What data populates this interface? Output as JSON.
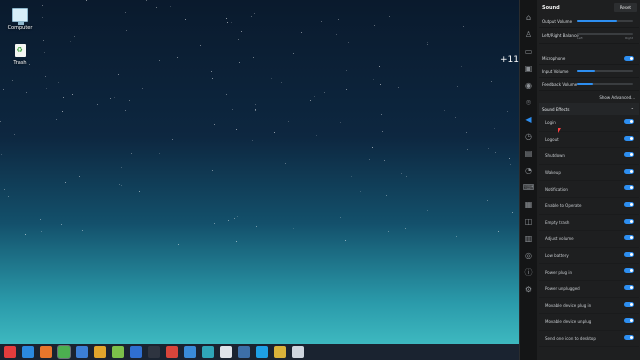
{
  "desktop": {
    "icons": [
      {
        "label": "Computer",
        "icon": "computer-icon"
      },
      {
        "label": "Trash",
        "icon": "trash-icon"
      }
    ],
    "temperature": "+11°"
  },
  "taskbar": {
    "items": [
      {
        "icon": "launcher-icon",
        "color": "#e43d3d"
      },
      {
        "icon": "show-desktop-icon",
        "color": "#2b8ae0"
      },
      {
        "icon": "firefox-icon",
        "color": "#e8762b"
      },
      {
        "icon": "chrome-icon",
        "color": "#4caf50"
      },
      {
        "icon": "file-manager-icon",
        "color": "#3c7fd6"
      },
      {
        "icon": "archive-icon",
        "color": "#e0a52c"
      },
      {
        "icon": "android-studio-icon",
        "color": "#7cc04a"
      },
      {
        "icon": "video-player-icon",
        "color": "#2f6fd1"
      },
      {
        "icon": "terminal-icon",
        "color": "#2e3440"
      },
      {
        "icon": "presentation-icon",
        "color": "#d8453b"
      },
      {
        "icon": "image-viewer-icon",
        "color": "#3a8bd8"
      },
      {
        "icon": "system-monitor-icon",
        "color": "#2fa6b8"
      },
      {
        "icon": "text-editor-icon",
        "color": "#dfe4ea"
      },
      {
        "icon": "screenshot-icon",
        "color": "#3d6fa8"
      },
      {
        "icon": "skype-icon",
        "color": "#1ea0e6"
      },
      {
        "icon": "tool-icon",
        "color": "#d9b23a"
      },
      {
        "icon": "settings-icon",
        "color": "#cfd6de"
      }
    ],
    "active_index": 3
  },
  "panel": {
    "title": "Sound",
    "reset_label": "Reset",
    "nav_icons": [
      {
        "name": "home-icon",
        "glyph": "⌂"
      },
      {
        "name": "user-icon",
        "glyph": "♙"
      },
      {
        "name": "display-icon",
        "glyph": "▭"
      },
      {
        "name": "default-apps-icon",
        "glyph": "▣"
      },
      {
        "name": "personalization-icon",
        "glyph": "◉"
      },
      {
        "name": "network-icon",
        "glyph": "⌾"
      },
      {
        "name": "sound-icon",
        "glyph": "◀"
      },
      {
        "name": "time-icon",
        "glyph": "◷"
      },
      {
        "name": "power-icon",
        "glyph": "▤"
      },
      {
        "name": "mouse-icon",
        "glyph": "◔"
      },
      {
        "name": "keyboard-icon",
        "glyph": "⌨"
      },
      {
        "name": "update-icon",
        "glyph": "▦"
      },
      {
        "name": "wacom-icon",
        "glyph": "◫"
      },
      {
        "name": "printer-icon",
        "glyph": "▥"
      },
      {
        "name": "accessibility-icon",
        "glyph": "◎"
      },
      {
        "name": "info-icon",
        "glyph": "ⓘ"
      },
      {
        "name": "general-settings-icon",
        "glyph": "⚙"
      }
    ],
    "active_nav_index": 6,
    "output_volume": {
      "label": "Output Volume",
      "percent": 72
    },
    "balance": {
      "label": "Left/Right Balance",
      "left": "Left",
      "right": "Right",
      "percent": 50
    },
    "microphone": {
      "label": "Microphone",
      "enabled": true
    },
    "input_volume": {
      "label": "Input Volume",
      "percent": 32
    },
    "feedback_volume": {
      "label": "Feedback Volume",
      "percent": 28
    },
    "show_advanced": "Show Advanced...",
    "sound_effects_header": "Sound Effects",
    "effects": [
      {
        "label": "Login",
        "enabled": true
      },
      {
        "label": "Logout",
        "enabled": true
      },
      {
        "label": "Shutdown",
        "enabled": true
      },
      {
        "label": "Wakeup",
        "enabled": true
      },
      {
        "label": "Notification",
        "enabled": true
      },
      {
        "label": "Enable to Operate",
        "enabled": true
      },
      {
        "label": "Empty trash",
        "enabled": true
      },
      {
        "label": "Adjust volume",
        "enabled": true
      },
      {
        "label": "Low battery",
        "enabled": true
      },
      {
        "label": "Power plug in",
        "enabled": true
      },
      {
        "label": "Power unplugged",
        "enabled": true
      },
      {
        "label": "Movable device plug in",
        "enabled": true
      },
      {
        "label": "Movable device unplug",
        "enabled": true
      },
      {
        "label": "Send one icon to desktop",
        "enabled": true
      }
    ]
  }
}
